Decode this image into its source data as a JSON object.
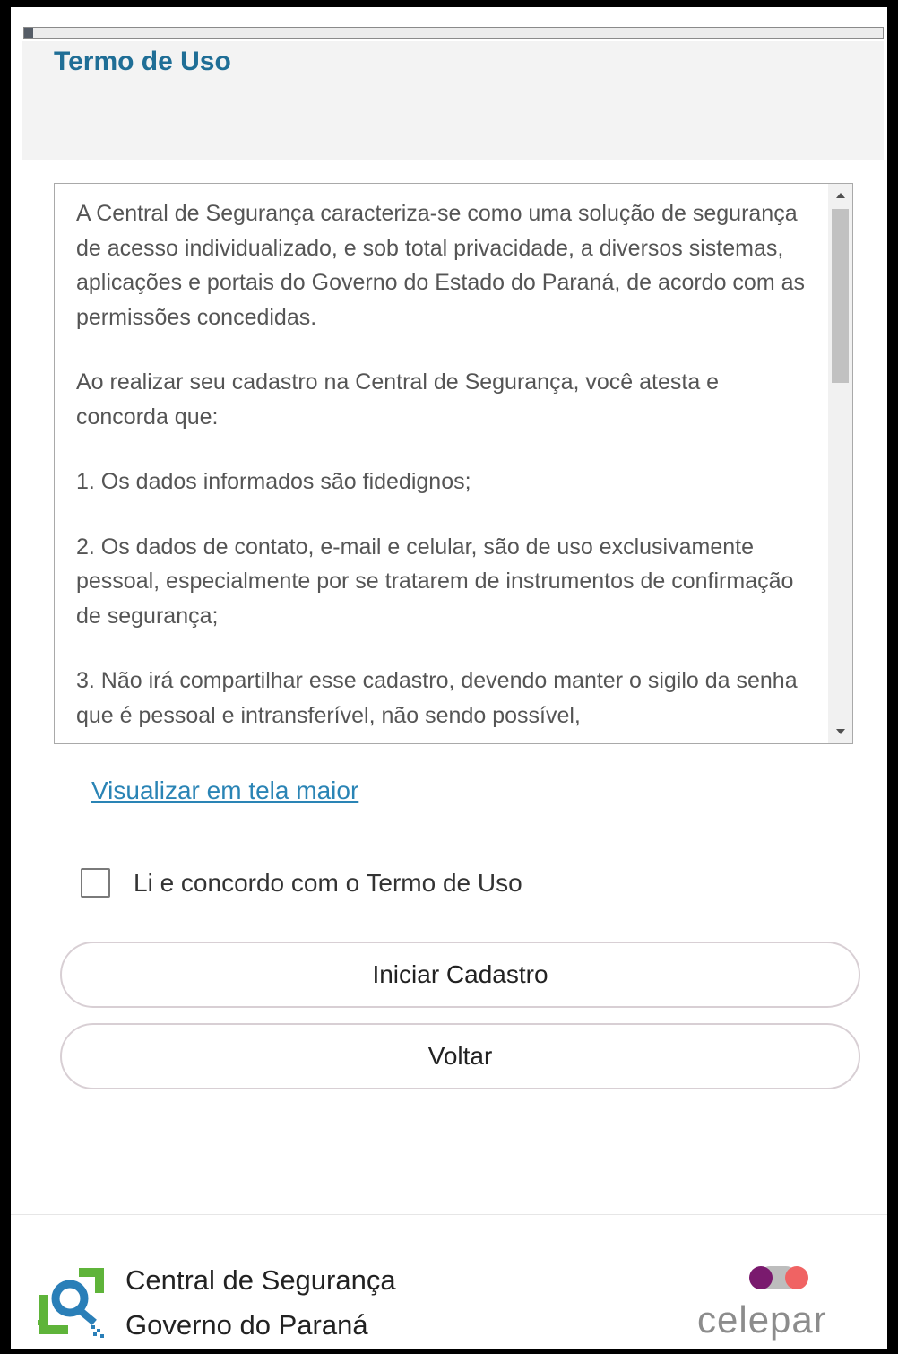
{
  "progress": {
    "value": 0.01
  },
  "header": {
    "title": "Termo de Uso"
  },
  "terms": {
    "paragraphs": [
      "A Central de Segurança caracteriza-se como uma solução de segurança de acesso individualizado, e sob total privacidade, a diversos sistemas, aplicações e portais do Governo do Estado do Paraná, de acordo com as permissões concedidas.",
      "Ao realizar seu cadastro na Central de Segurança, você atesta e concorda que:",
      "1. Os dados informados são fidedignos;",
      "2. Os dados de contato, e-mail e celular, são de uso exclusivamente pessoal, especialmente por se tratarem de instrumentos de confirmação de segurança;",
      "3. Não irá compartilhar esse cadastro, devendo manter o sigilo da senha que é pessoal e intransferível, não sendo possível,"
    ]
  },
  "links": {
    "view_larger": "Visualizar em tela maior"
  },
  "agreement": {
    "label": "Li e concordo com o Termo de Uso",
    "checked": false
  },
  "buttons": {
    "start": "Iniciar Cadastro",
    "back": "Voltar"
  },
  "footer": {
    "brand_line1": "Central de Segurança",
    "brand_line2": "Governo do Paraná",
    "partner_logo_text": "celepar"
  },
  "colors": {
    "title": "#1f6e96",
    "link": "#2a84b5",
    "logo_green": "#5fb43a",
    "logo_blue": "#2a7fb8",
    "celepar_purple": "#7a1a6e",
    "celepar_coral": "#f06363"
  }
}
